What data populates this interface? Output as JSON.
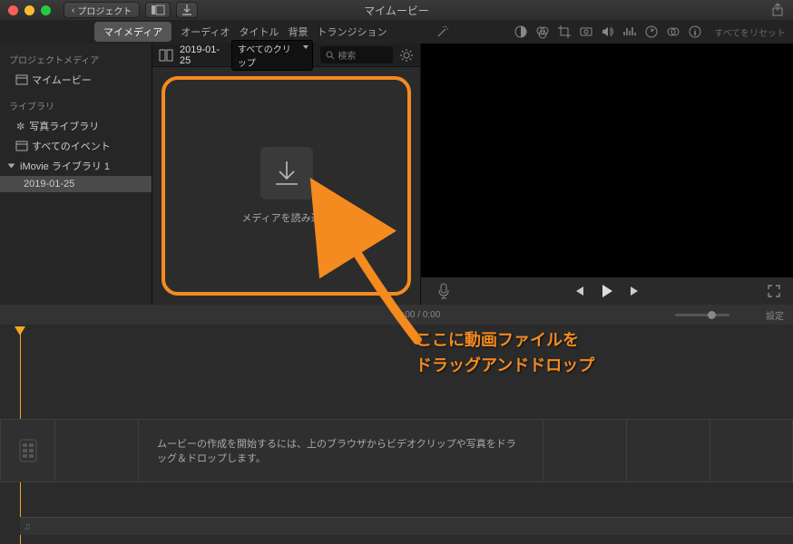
{
  "titlebar": {
    "title": "マイムービー",
    "back_label": "プロジェクト"
  },
  "tabs": {
    "mymedia": "マイメディア",
    "audio": "オーディオ",
    "title": "タイトル",
    "bg": "背景",
    "transition": "トランジション",
    "reset": "すべてをリセット"
  },
  "sidebar": {
    "project_media_head": "プロジェクトメディア",
    "my_movie": "マイムービー",
    "library_head": "ライブラリ",
    "photo_lib": "写真ライブラリ",
    "all_events": "すべてのイベント",
    "imovie_lib": "iMovie ライブラリ 1",
    "event_date": "2019-01-25"
  },
  "browser": {
    "date": "2019-01-25",
    "filter_label": "すべてのクリップ",
    "search_placeholder": "検索"
  },
  "dropzone": {
    "label": "メディアを読み込む"
  },
  "timecode": {
    "current": "0:00",
    "total": "0:00",
    "settings_label": "設定"
  },
  "timeline": {
    "hint": "ムービーの作成を開始するには、上のブラウザからビデオクリップや写真をドラッグ＆ドロップします。"
  },
  "annotation": {
    "line1": "ここに動画ファイルを",
    "line2": "ドラッグアンドドロップ"
  }
}
